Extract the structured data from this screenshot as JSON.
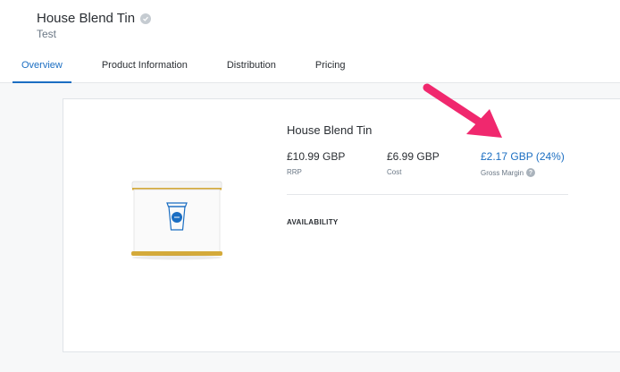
{
  "header": {
    "title": "House Blend Tin",
    "subtitle": "Test"
  },
  "tabs": [
    {
      "label": "Overview",
      "active": true
    },
    {
      "label": "Product Information",
      "active": false
    },
    {
      "label": "Distribution",
      "active": false
    },
    {
      "label": "Pricing",
      "active": false
    }
  ],
  "product": {
    "name": "House Blend Tin",
    "rrp": {
      "value": "£10.99 GBP",
      "label": "RRP"
    },
    "cost": {
      "value": "£6.99 GBP",
      "label": "Cost"
    },
    "margin": {
      "value": "£2.17 GBP  (24%)",
      "label": "Gross Margin"
    },
    "availability_heading": "AVAILABILITY"
  },
  "colors": {
    "accent": "#1b6ec2",
    "annotation_arrow": "#f0286e",
    "tin_gold": "#d4aa3a"
  },
  "icons": {
    "verified": "check-badge-icon",
    "help": "question-mark-icon",
    "product": "coffee-cup-icon"
  }
}
